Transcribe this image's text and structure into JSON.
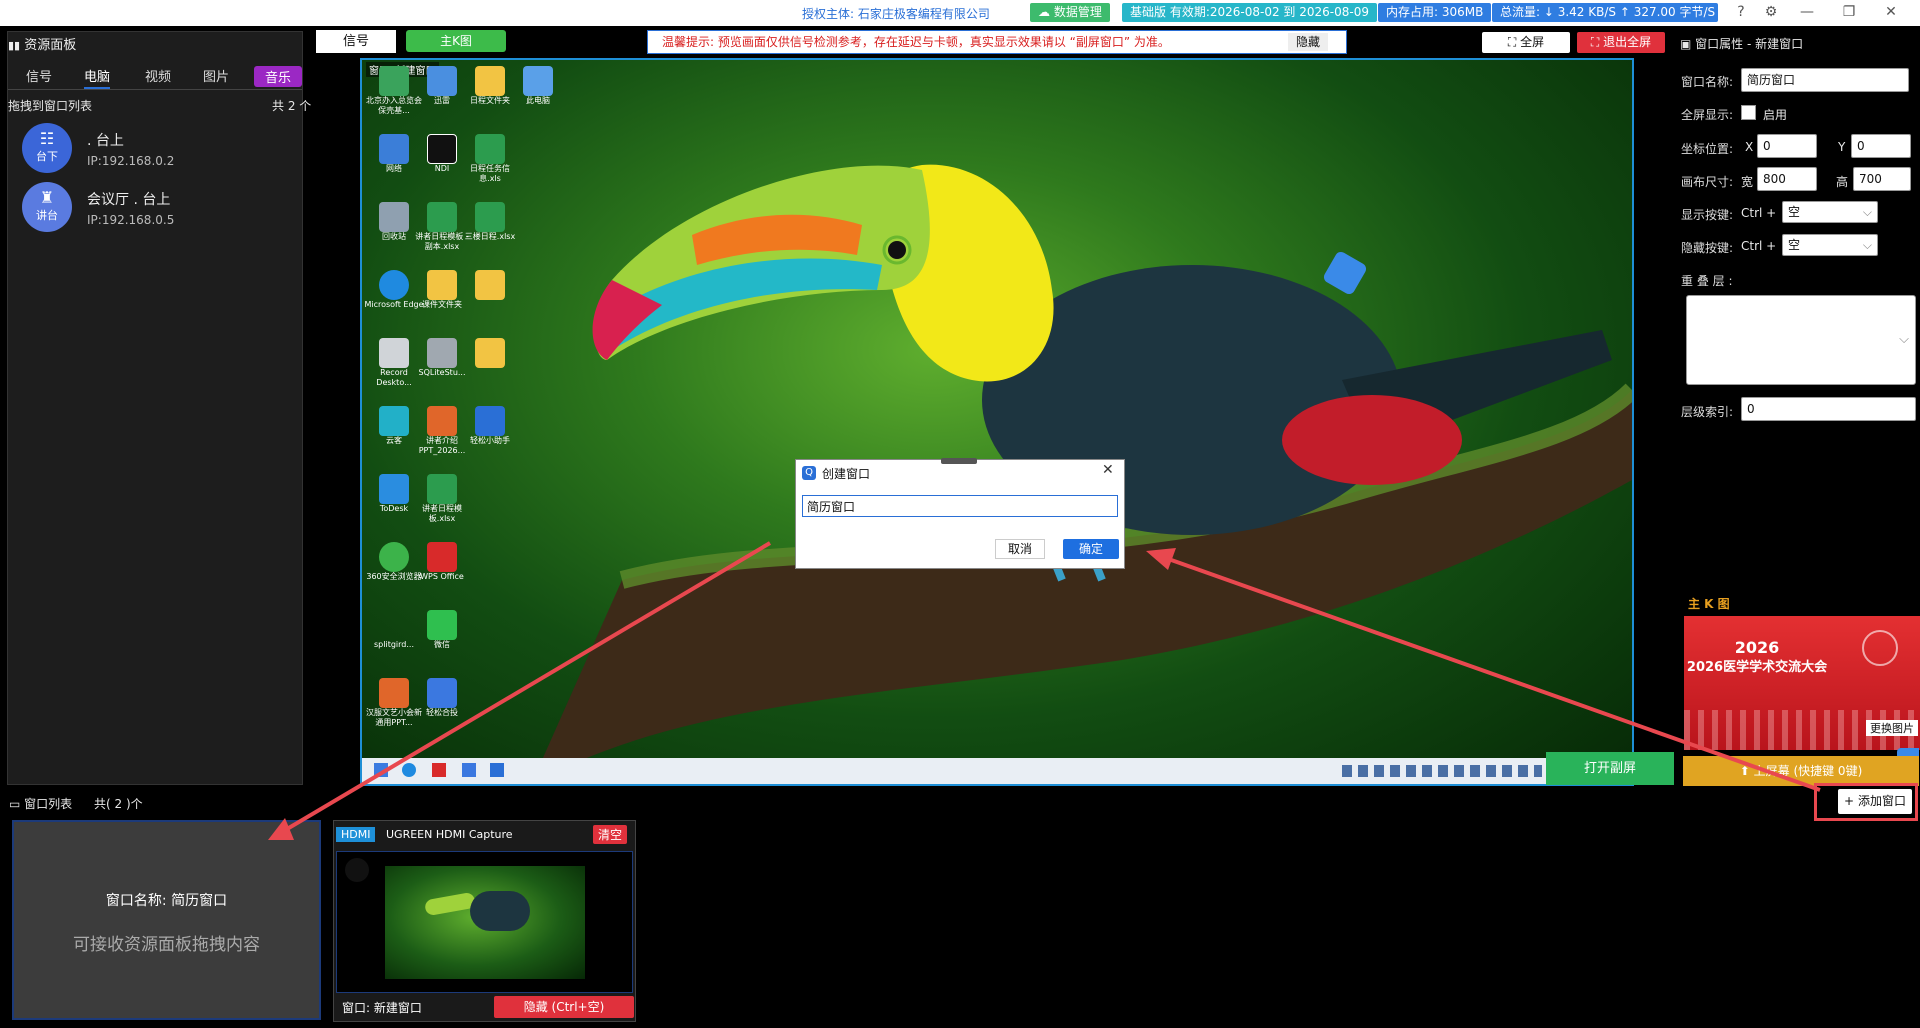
{
  "topbar": {
    "license_text": "授权主体: 石家庄极客编程有限公司",
    "data_mgmt": "数据管理",
    "version": "基础版 有效期:2026-08-02 到 2026-08-09",
    "memory": "内存占用: 306MB",
    "flow": "总流量: ↓ 3.42 KB/S   ↑ 327.00 字节/S",
    "colors": {
      "green": "#3dbb6d",
      "cyan": "#27b6c9",
      "blue": "#2f7de1"
    }
  },
  "left_panel": {
    "title": "资源面板",
    "tabs": [
      "信号",
      "电脑",
      "视频",
      "图片",
      "音乐"
    ],
    "active_tab": "电脑",
    "list_header": "拖拽到窗口列表",
    "count": "共 2 个",
    "devices": [
      {
        "name": ". 台上",
        "ip": "IP:192.168.0.2",
        "badge": "台下",
        "icon": "list-icon"
      },
      {
        "name": "会议厅 . 台上",
        "ip": "IP:192.168.0.5",
        "badge": "讲台",
        "icon": "podium-icon"
      }
    ]
  },
  "toolbar": {
    "signal": "信号",
    "main_k": "主K图",
    "hint": "温馨提示: 预览画面仅供信号检测参考，存在延迟与卡顿，真实显示效果请以 “副屏窗口” 为准。",
    "hide": "隐藏",
    "fullscreen": "全屏",
    "exit_fullscreen": "退出全屏"
  },
  "preview": {
    "window_label": "窗口: 新建窗口",
    "desktop_icons": [
      "北京办入总览会保壳基...",
      "迅雷",
      "日程文件夹",
      "此电脑",
      "网络",
      "NDI",
      "日程任务信息.xls",
      "回收站",
      "讲者日程模板 - 副本.xlsx",
      "三楼日程.xlsx",
      "Microsoft Edge",
      "课件文件夹",
      "Record Deskto...",
      "SQLiteStu...",
      "云客",
      "讲者介绍PPT_2026...",
      "轻松小助手",
      "ToDesk",
      "讲者日程模板.xlsx",
      "360安全浏览器",
      "WPS Office",
      "splitgird...",
      "微信",
      "汉服文艺小会新通用PPT...",
      "轻松合投"
    ]
  },
  "dialog": {
    "title": "创建窗口",
    "input_value": "简历窗口",
    "cancel": "取消",
    "ok": "确定"
  },
  "right_panel": {
    "title": "窗口属性 - 新建窗口",
    "window_name_label": "窗口名称:",
    "window_name_value": "简历窗口",
    "fullscreen_label": "全屏显示:",
    "enable_label": "启用",
    "position_label": "坐标位置:",
    "x_label": "X",
    "x_value": "0",
    "y_label": "Y",
    "y_value": "0",
    "canvas_label": "画布尺寸:",
    "w_label": "宽",
    "w_value": "800",
    "h_label": "高",
    "h_value": "700",
    "show_key_label": "显示按键:",
    "hide_key_label": "隐藏按键:",
    "ctrl": "Ctrl +",
    "empty": "空",
    "overlay_label": "重 叠 层 :",
    "layer_index_label": "层级索引:",
    "layer_index_value": "0",
    "main_k_label": "主 K 图",
    "main_k_poster_year": "2026",
    "main_k_poster_title": "2026医学学术交流大会",
    "change_image": "更换图片",
    "open_secondary": "打开副屏",
    "upscreen": "上屏幕 (快捷键 0键)",
    "add_window": "添加窗口"
  },
  "bottom": {
    "list_title": "窗口列表",
    "list_count": "共( 2 )个",
    "card1_name": "窗口名称: 简历窗口",
    "card1_hint": "可接收资源面板拖拽内容",
    "card2_badge": "HDMI",
    "card2_title": "UGREEN HDMI Capture",
    "card2_clear": "清空",
    "card2_window": "窗口: 新建窗口",
    "card2_hide": "隐藏 (Ctrl+空)"
  }
}
